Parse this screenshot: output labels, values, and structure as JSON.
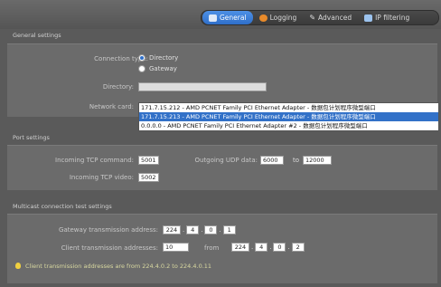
{
  "tabs": [
    {
      "label": "General",
      "icon": "general-icon",
      "active": true
    },
    {
      "label": "Logging",
      "icon": "logging-icon",
      "active": false
    },
    {
      "label": "Advanced",
      "icon": "advanced-icon",
      "active": false
    },
    {
      "label": "IP filtering",
      "icon": "ip-filtering-icon",
      "active": false
    }
  ],
  "general": {
    "title": "General settings",
    "connection_type_label": "Connection type:",
    "option_directory": "Directory",
    "option_gateway": "Gateway",
    "selected_option": "Directory",
    "directory_label": "Directory:",
    "directory_value": "",
    "network_card_label": "Network card:",
    "network_card_value": "171.7.15.212 - AMD PCNET Family PCI Ethernet Adapter - 数据包计划程序微型端口",
    "network_card_options": [
      "171.7.15.213 - AMD PCNET Family PCI Ethernet Adapter - 数据包计划程序微型端口",
      "0.0.0.0 - AMD PCNET Family PCI Ethernet Adapter #2 - 数据包计划程序微型端口"
    ],
    "network_card_highlighted": "171.7.15.213 - AMD PCNET Family PCI Ethernet Adapter - 数据包计划程序微型端口"
  },
  "ports": {
    "title": "Port settings",
    "tcp_command_label": "Incoming TCP command:",
    "tcp_command_value": "5001",
    "udp_data_label": "Outgoing UDP data:",
    "udp_from": "6000",
    "udp_to_label": "to",
    "udp_to": "12000",
    "tcp_video_label": "Incoming TCP video:",
    "tcp_video_value": "5002"
  },
  "multicast": {
    "title": "Multicast connection test settings",
    "gateway_label": "Gateway transmission address:",
    "gateway_ip": [
      "224",
      "4",
      "0",
      "1"
    ],
    "client_label": "Client transmission addresses:",
    "client_count": "10",
    "from_label": "from",
    "client_ip": [
      "224",
      "4",
      "0",
      "2"
    ],
    "note": "Client transmission addresses are from 224.4.0.2 to 224.4.0.11"
  },
  "colors": {
    "accent": "#3271c8",
    "background": "#5a5a5a",
    "panel": "#6b6b6b"
  }
}
